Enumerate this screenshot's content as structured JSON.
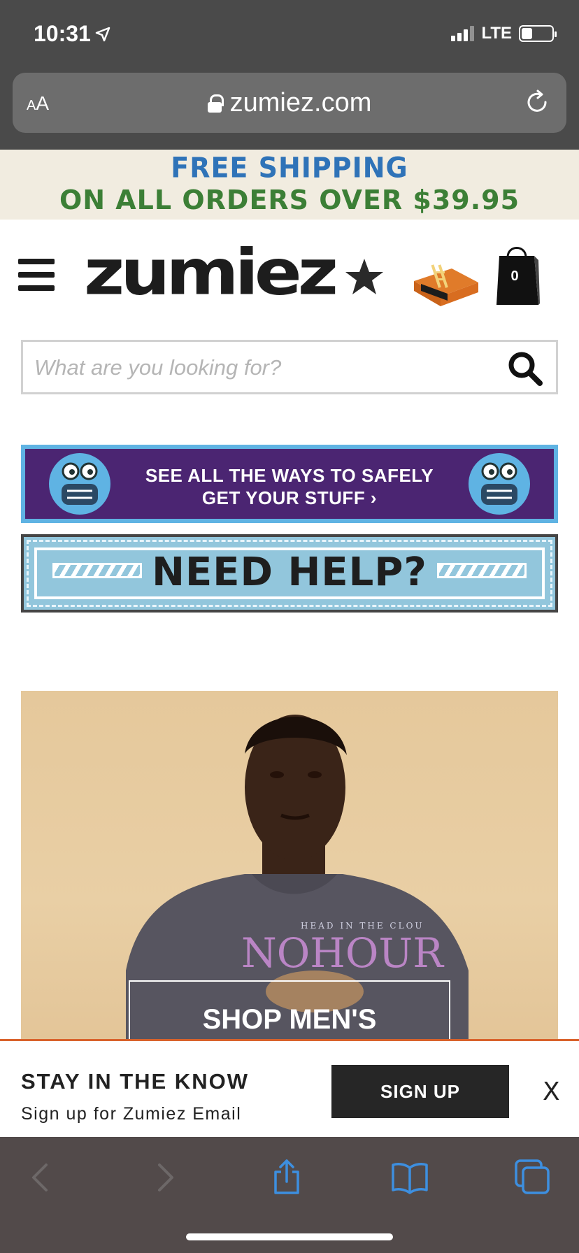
{
  "status_bar": {
    "time": "10:31",
    "network": "LTE",
    "battery_level": 0.35
  },
  "browser": {
    "text_size_label_small": "A",
    "text_size_label_large": "A",
    "url": "zumiez.com"
  },
  "promo": {
    "line1": "FREE SHIPPING",
    "line2": "ON ALL ORDERS OVER $39.95"
  },
  "header": {
    "logo": "zumiez",
    "cart_count": "0"
  },
  "search": {
    "placeholder": "What are you looking for?"
  },
  "banners": {
    "ways_line1": "SEE ALL THE WAYS TO SAFELY",
    "ways_line2": "GET YOUR STUFF ›",
    "help": "NEED HELP?"
  },
  "hero": {
    "cta": "SHOP MEN'S"
  },
  "email_signup": {
    "title": "STAY IN THE KNOW",
    "subtitle": "Sign up for Zumiez Email",
    "button": "SIGN UP",
    "close": "X"
  },
  "toolbar": {
    "icons": [
      "back-icon",
      "forward-icon",
      "share-icon",
      "bookmarks-icon",
      "tabs-icon"
    ]
  },
  "colors": {
    "promo_blue": "#2f73b8",
    "promo_green": "#3c7f36",
    "ways_purple": "#4b2572",
    "ways_border": "#5fb3e3",
    "help_blue": "#92c6dc",
    "email_accent": "#d9622b",
    "toolbar_accent": "#3d8fe0"
  }
}
